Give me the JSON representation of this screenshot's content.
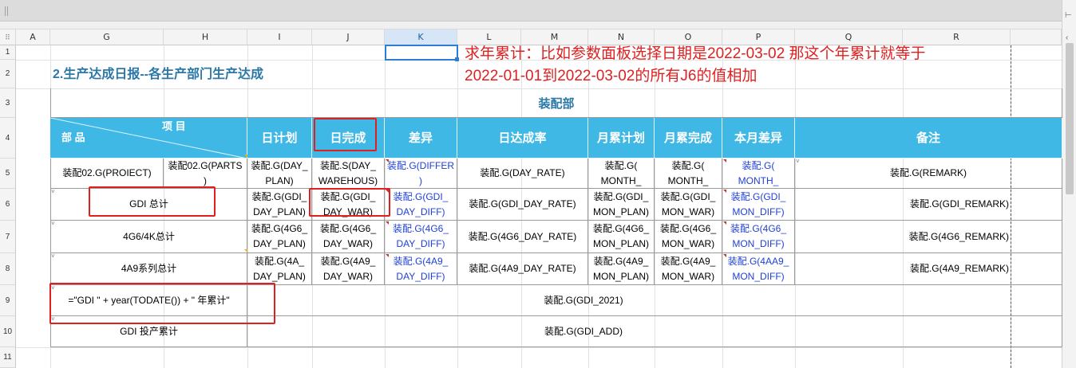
{
  "toolbar": {
    "corner_icon": "grid-icon",
    "panel_icon_1": "ruler-icon",
    "panel_icon_2": "chevron-left-icon"
  },
  "columns": [
    "A",
    "G",
    "H",
    "I",
    "J",
    "K",
    "L",
    "M",
    "N",
    "O",
    "P",
    "Q",
    "R"
  ],
  "rows": [
    "1",
    "2",
    "3",
    "4",
    "5",
    "6",
    "7",
    "8",
    "9",
    "10",
    "11"
  ],
  "annotation": {
    "line1": "求年累计：比如参数面板选择日期是2022-03-02  那这个年累计就等于",
    "line2": "2022-01-01到2022-03-02的所有J6的值相加"
  },
  "report": {
    "title": "2.生产达成日报--各生产部门生产达成",
    "section": "装配部",
    "header": {
      "diag_top": "项  目",
      "diag_bottom": "部  品",
      "plan": "日计划",
      "done": "日完成",
      "diff": "差异",
      "rate": "日达成率",
      "mon_plan": "月累计划",
      "mon_done": "月累完成",
      "mon_diff": "本月差异",
      "remark": "备注"
    },
    "rows": [
      {
        "a": "装配02.G(PROIECT)",
        "b": "装配02.G(PARTS\n)",
        "plan": "装配.G(DAY_\nPLAN)",
        "done": "装配.S(DAY_\nWAREHOUS)",
        "diff": "装配.G(DIFFER\n)",
        "rate": "装配.G(DAY_RATE)",
        "mon_plan": "装配.G(\nMONTH_",
        "mon_done": "装配.G(\nMONTH_",
        "mon_diff": "装配.G(\nMONTH_",
        "remark": "装配.G(REMARK)"
      },
      {
        "a": "GDI 总计",
        "plan": "装配.G(GDI_\nDAY_PLAN)",
        "done": "装配.G(GDI_\nDAY_WAR)",
        "diff": "装配.G(GDI_\nDAY_DIFF)",
        "rate": "装配.G(GDI_DAY_RATE)",
        "mon_plan": "装配.G(GDI_\nMON_PLAN)",
        "mon_done": "装配.G(GDI_\nMON_WAR)",
        "mon_diff": "装配.G(GDI_\nMON_DIFF)",
        "remark": "装配.G(GDI_REMARK)"
      },
      {
        "a": "4G6/4K总计",
        "plan": "装配.G(4G6_\nDAY_PLAN)",
        "done": "装配.G(4G6_\nDAY_WAR)",
        "diff": "装配.G(4G6_\nDAY_DIFF)",
        "rate": "装配.G(4G6_DAY_RATE)",
        "mon_plan": "装配.G(4G6_\nMON_PLAN)",
        "mon_done": "装配.G(4G6_\nMON_WAR)",
        "mon_diff": "装配.G(4G6_\nMON_DIFF)",
        "remark": "装配.G(4G6_REMARK)"
      },
      {
        "a": "4A9系列总计",
        "plan": "装配.G(4A_\nDAY_PLAN)",
        "done": "装配.G(4A9_\nDAY_WAR)",
        "diff": "装配.G(4A9_\nDAY_DIFF)",
        "rate": "装配.G(4A9_DAY_RATE)",
        "mon_plan": "装配.G(4A9_\nMON_PLAN)",
        "mon_done": "装配.G(4A9_\nMON_WAR)",
        "mon_diff": "装配.G(4AA9_\nMON_DIFF)",
        "remark": "装配.G(4A9_REMARK)"
      }
    ],
    "formula_label": "=\"GDI \" + year(TODATE()) + \" 年累计\"",
    "formula_value": "装配.G(GDI_2021)",
    "add_label": "GDI 投产累计",
    "add_value": "装配.G(GDI_ADD)"
  }
}
